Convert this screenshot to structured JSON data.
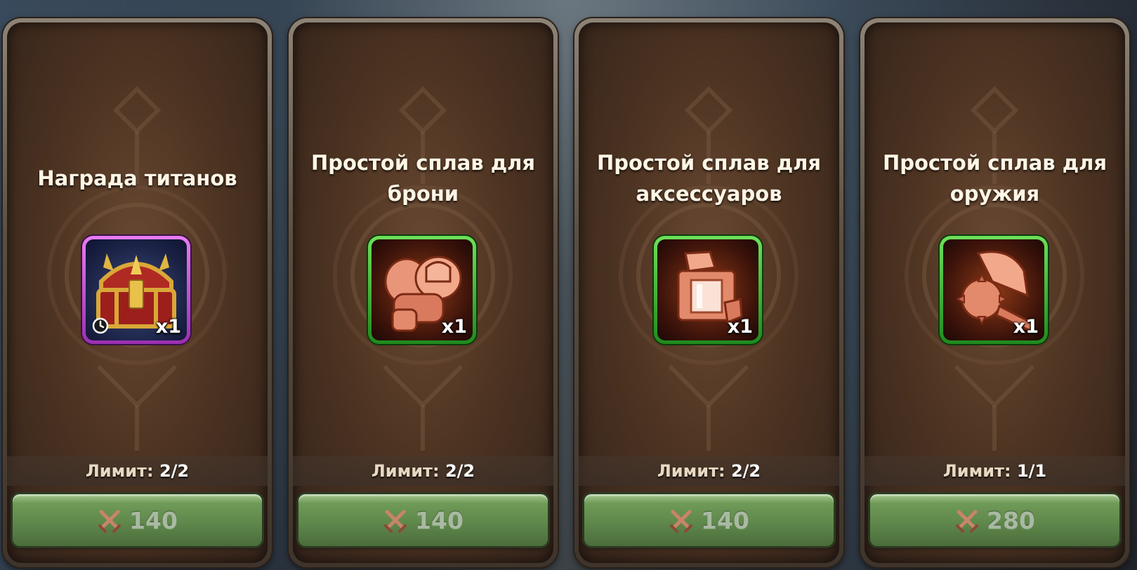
{
  "colors": {
    "card_frame": "#8d8376",
    "card_fill": "#4e3422",
    "button_green": "#6f9a57",
    "price_text": "#a9b9a2",
    "slot_purple": "#c04fd6",
    "slot_green": "#3dbb35"
  },
  "limit_label": "Лимит:",
  "offers": [
    {
      "title": "Награда титанов",
      "icon": "titan-chest-icon",
      "rarity": "purple",
      "quantity": "x1",
      "timed": true,
      "limit": "2/2",
      "price": "140",
      "currency_icon": "crossed-swords-icon"
    },
    {
      "title": "Простой сплав для\nброни",
      "icon": "armor-alloy-icon",
      "rarity": "green",
      "quantity": "x1",
      "timed": false,
      "limit": "2/2",
      "price": "140",
      "currency_icon": "crossed-swords-icon"
    },
    {
      "title": "Простой сплав для\nаксессуаров",
      "icon": "accessory-alloy-icon",
      "rarity": "green",
      "quantity": "x1",
      "timed": false,
      "limit": "2/2",
      "price": "140",
      "currency_icon": "crossed-swords-icon"
    },
    {
      "title": "Простой сплав для\nоружия",
      "icon": "weapon-alloy-icon",
      "rarity": "green",
      "quantity": "x1",
      "timed": false,
      "limit": "1/1",
      "price": "280",
      "currency_icon": "crossed-swords-icon"
    }
  ]
}
